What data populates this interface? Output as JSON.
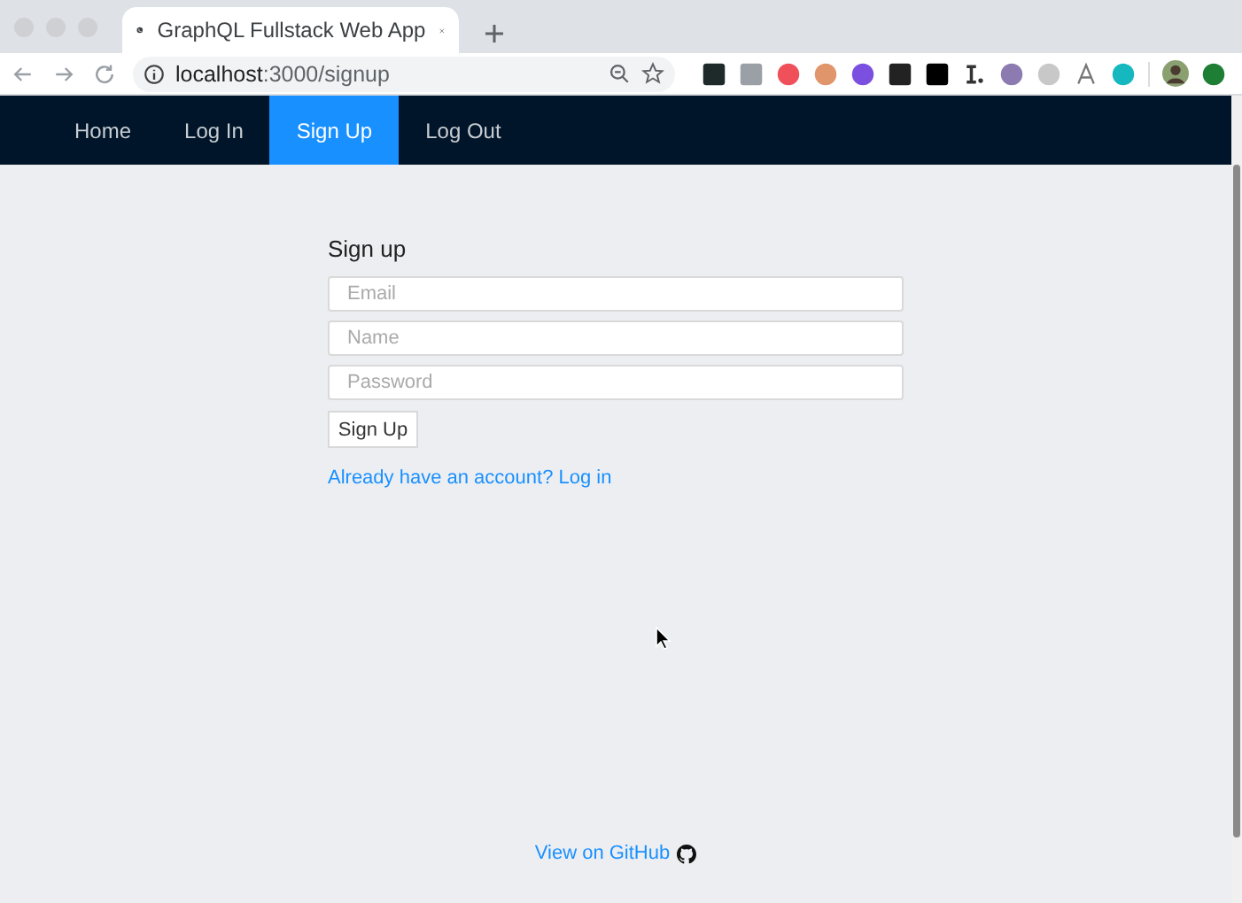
{
  "browser": {
    "tab": {
      "title": "GraphQL Fullstack Web App"
    },
    "address": "**localhost**:3000/signup"
  },
  "nav": [
    {
      "label": "Home",
      "selected": false
    },
    {
      "label": "Log In",
      "selected": false
    },
    {
      "label": "Sign Up",
      "selected": true
    },
    {
      "label": "Log Out",
      "selected": false
    }
  ],
  "form": {
    "title": "Sign up",
    "fields": [
      {
        "placeholder": "Email"
      },
      {
        "placeholder": "Name"
      },
      {
        "placeholder": "Password"
      }
    ],
    "button": "Sign Up",
    "link": "Already have an account? Log in"
  },
  "footer": {
    "link": "View on GitHub"
  }
}
